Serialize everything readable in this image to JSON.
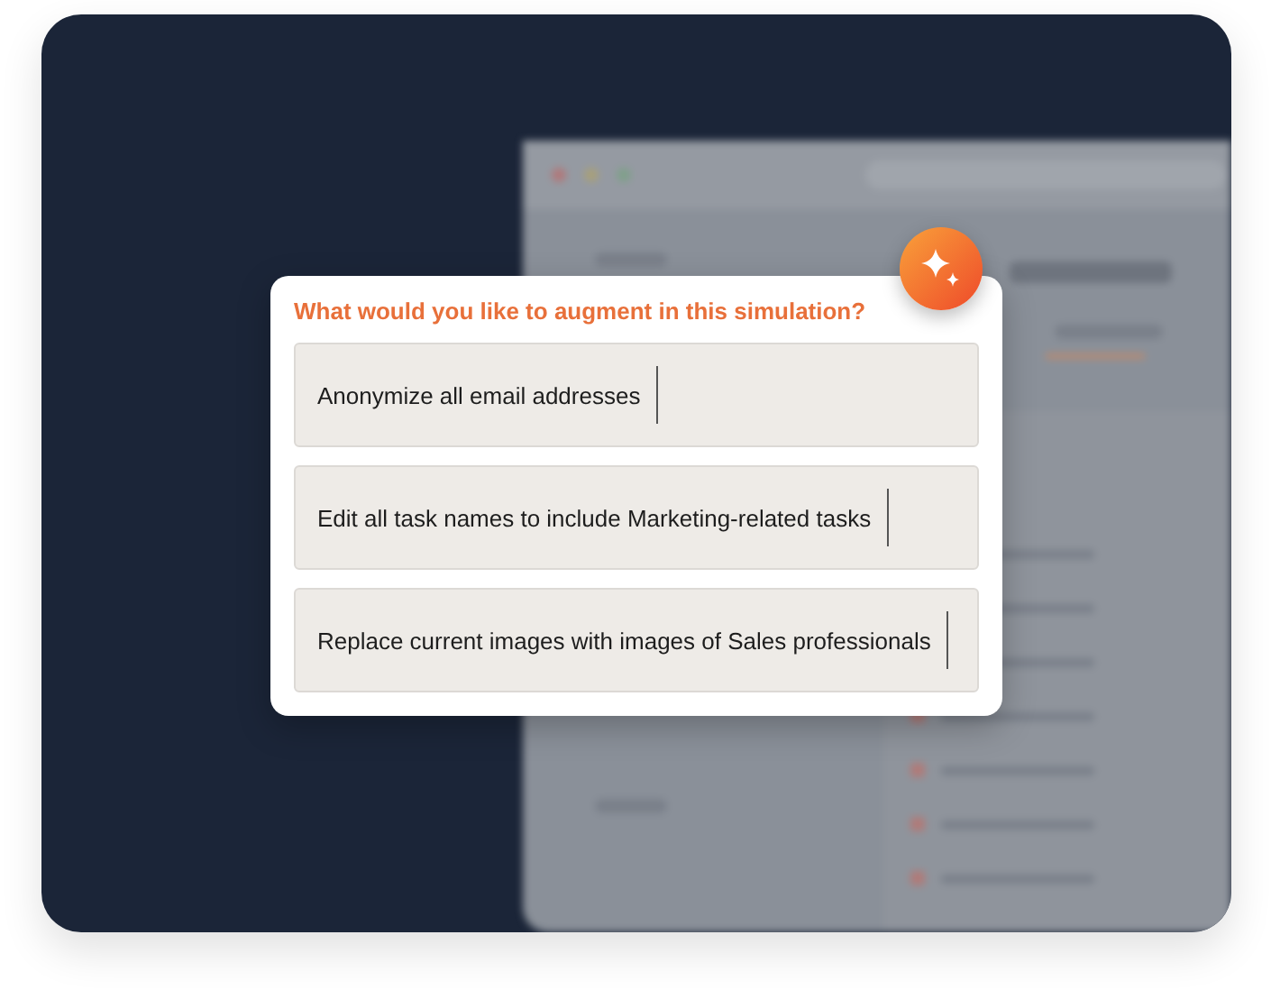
{
  "dialog": {
    "title": "What would you like to augment in this simulation?",
    "prompts": [
      {
        "value": "Anonymize all email addresses"
      },
      {
        "value": "Edit all task names to include Marketing-related tasks"
      },
      {
        "value": "Replace current images with images of Sales professionals"
      }
    ]
  }
}
